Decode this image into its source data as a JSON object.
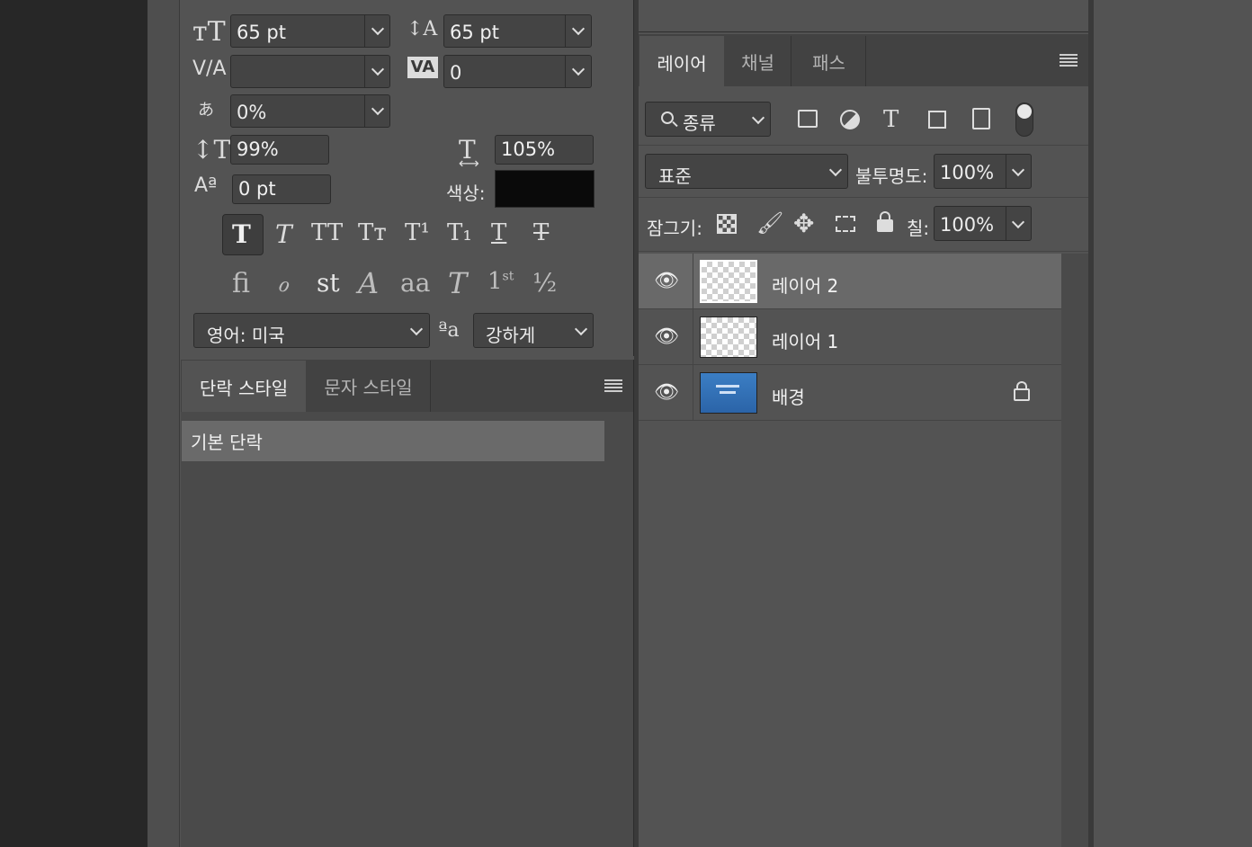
{
  "character": {
    "font_size": "65 pt",
    "leading": "65 pt",
    "kerning": "",
    "tracking": "0",
    "tsume": "0%",
    "vertical_scale": "99%",
    "horizontal_scale": "105%",
    "baseline_shift": "0 pt",
    "color_label": "색상:",
    "color_value": "#0a0a0a",
    "language": "영어: 미국",
    "anti_alias_icon": "ªa",
    "anti_alias": "강하게",
    "type_styles": [
      "T",
      "T",
      "TT",
      "Tт",
      "T¹",
      "T₁",
      "T",
      "T"
    ],
    "opentype": [
      "ﬁ",
      "ℴ",
      "st",
      "𝒜",
      "aa",
      "T",
      "1st",
      "½"
    ]
  },
  "paragraph_styles": {
    "tabs": [
      "단락 스타일",
      "문자 스타일"
    ],
    "items": [
      "기본 단락"
    ]
  },
  "layers": {
    "tabs": [
      "레이어",
      "채널",
      "패스"
    ],
    "filter_label": "종류",
    "blend_mode": "표준",
    "opacity_label": "불투명도:",
    "opacity": "100%",
    "lock_label": "잠그기:",
    "fill_label": "칠:",
    "fill": "100%",
    "items": [
      {
        "name": "레이어 2",
        "selected": true,
        "locked": false
      },
      {
        "name": "레이어 1",
        "selected": false,
        "locked": false
      },
      {
        "name": "배경",
        "selected": false,
        "locked": true
      }
    ]
  },
  "colors": {
    "panel_bg": "#535353",
    "dark_bg": "#272727",
    "selected_row": "#696969",
    "thumb_blue": "#2f6fb5"
  }
}
